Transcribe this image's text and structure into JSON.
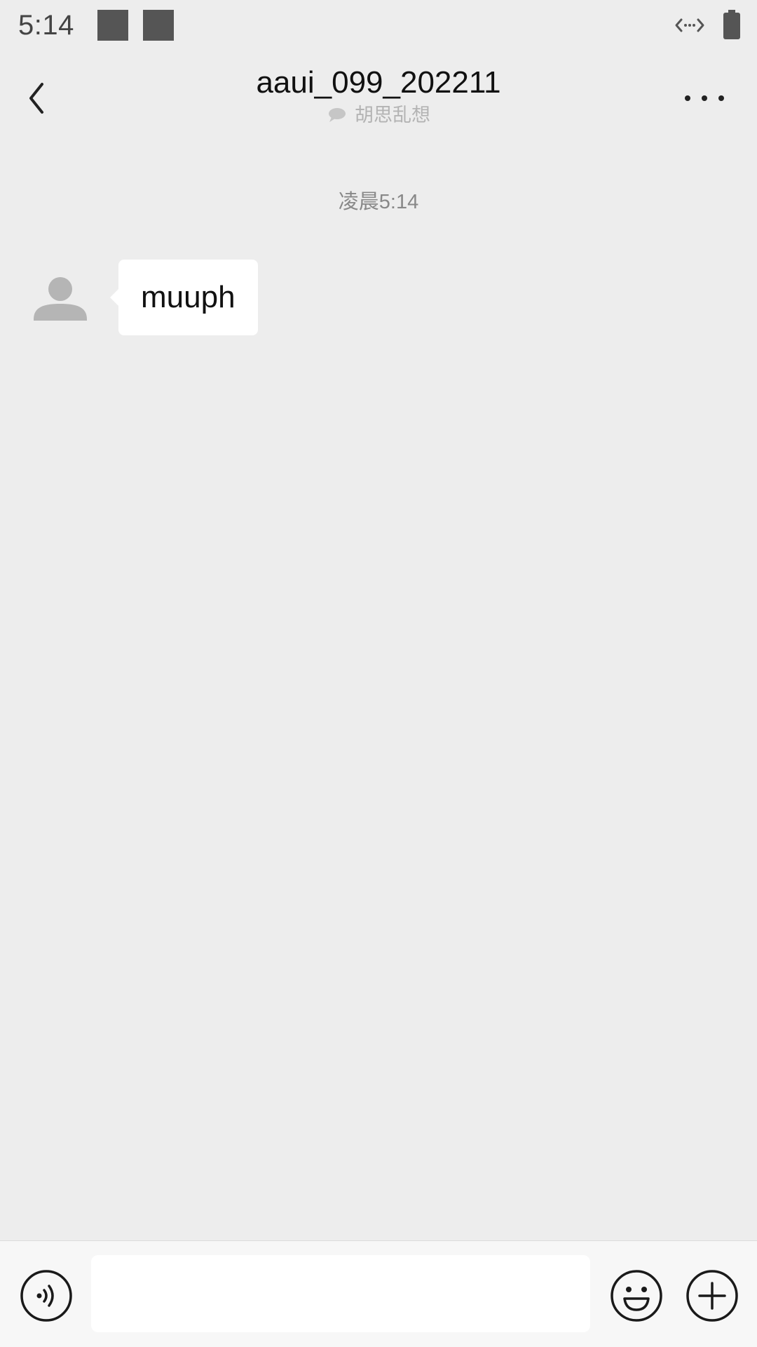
{
  "status_bar": {
    "time": "5:14"
  },
  "header": {
    "title": "aaui_099_202211",
    "subtitle": "胡思乱想",
    "back_icon": "chevron-left-icon",
    "more_icon": "more-horizontal-icon",
    "subtitle_icon": "chat-bubble-icon"
  },
  "conversation": {
    "timestamp": "凌晨5:14",
    "messages": [
      {
        "sender": "other",
        "text": "muuph",
        "avatar_icon": "default-avatar-icon"
      }
    ]
  },
  "input_bar": {
    "voice_icon": "voice-icon",
    "input_value": "",
    "emoji_icon": "emoji-icon",
    "plus_icon": "plus-circle-icon"
  },
  "colors": {
    "background": "#ededed",
    "bubble": "#ffffff",
    "input_bar": "#f7f7f7",
    "subtitle": "#b3b3b3",
    "timestamp": "#888888"
  }
}
